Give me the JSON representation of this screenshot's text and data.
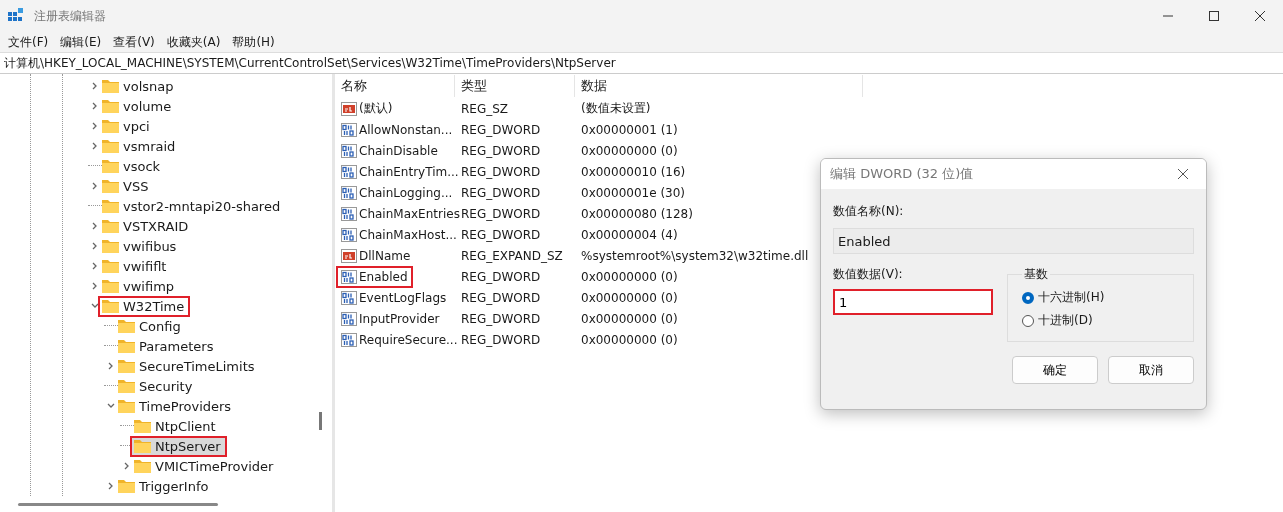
{
  "window": {
    "title": "注册表编辑器"
  },
  "menu": [
    "文件(F)",
    "编辑(E)",
    "查看(V)",
    "收藏夹(A)",
    "帮助(H)"
  ],
  "address": "计算机\\HKEY_LOCAL_MACHINE\\SYSTEM\\CurrentControlSet\\Services\\W32Time\\TimeProviders\\NtpServer",
  "tree": [
    {
      "label": "volsnap",
      "has_children": true,
      "expanded": false,
      "selected": false,
      "highlighted": false
    },
    {
      "label": "volume",
      "has_children": true,
      "expanded": false,
      "selected": false,
      "highlighted": false
    },
    {
      "label": "vpci",
      "has_children": true,
      "expanded": false,
      "selected": false,
      "highlighted": false
    },
    {
      "label": "vsmraid",
      "has_children": true,
      "expanded": false,
      "selected": false,
      "highlighted": false
    },
    {
      "label": "vsock",
      "has_children": false,
      "selected": false,
      "highlighted": false
    },
    {
      "label": "VSS",
      "has_children": true,
      "expanded": false,
      "selected": false,
      "highlighted": false
    },
    {
      "label": "vstor2-mntapi20-shared",
      "has_children": false,
      "selected": false,
      "highlighted": false
    },
    {
      "label": "VSTXRAID",
      "has_children": true,
      "expanded": false,
      "selected": false,
      "highlighted": false
    },
    {
      "label": "vwifibus",
      "has_children": true,
      "expanded": false,
      "selected": false,
      "highlighted": false
    },
    {
      "label": "vwififlt",
      "has_children": true,
      "expanded": false,
      "selected": false,
      "highlighted": false
    },
    {
      "label": "vwifimp",
      "has_children": true,
      "expanded": false,
      "selected": false,
      "highlighted": false
    },
    {
      "label": "W32Time",
      "has_children": true,
      "expanded": true,
      "selected": false,
      "highlighted": true,
      "children": [
        {
          "label": "Config",
          "has_children": false,
          "selected": false,
          "highlighted": false
        },
        {
          "label": "Parameters",
          "has_children": false,
          "selected": false,
          "highlighted": false
        },
        {
          "label": "SecureTimeLimits",
          "has_children": true,
          "expanded": false,
          "selected": false,
          "highlighted": false
        },
        {
          "label": "Security",
          "has_children": false,
          "selected": false,
          "highlighted": false
        },
        {
          "label": "TimeProviders",
          "has_children": true,
          "expanded": true,
          "selected": false,
          "highlighted": false,
          "children": [
            {
              "label": "NtpClient",
              "has_children": false,
              "selected": false,
              "highlighted": false
            },
            {
              "label": "NtpServer",
              "has_children": false,
              "selected": true,
              "highlighted": true
            },
            {
              "label": "VMICTimeProvider",
              "has_children": true,
              "expanded": false,
              "selected": false,
              "highlighted": false
            }
          ]
        },
        {
          "label": "TriggerInfo",
          "has_children": true,
          "expanded": false,
          "selected": false,
          "highlighted": false
        }
      ]
    }
  ],
  "values": {
    "columns": [
      "名称",
      "类型",
      "数据"
    ],
    "rows": [
      {
        "kind": "string",
        "name": "(默认)",
        "type": "REG_SZ",
        "data": "(数值未设置)",
        "highlighted": false
      },
      {
        "kind": "binary",
        "name": "AllowNonstan...",
        "type": "REG_DWORD",
        "data": "0x00000001 (1)",
        "highlighted": false
      },
      {
        "kind": "binary",
        "name": "ChainDisable",
        "type": "REG_DWORD",
        "data": "0x00000000 (0)",
        "highlighted": false
      },
      {
        "kind": "binary",
        "name": "ChainEntryTim...",
        "type": "REG_DWORD",
        "data": "0x00000010 (16)",
        "highlighted": false
      },
      {
        "kind": "binary",
        "name": "ChainLogging...",
        "type": "REG_DWORD",
        "data": "0x0000001e (30)",
        "highlighted": false
      },
      {
        "kind": "binary",
        "name": "ChainMaxEntries",
        "type": "REG_DWORD",
        "data": "0x00000080 (128)",
        "highlighted": false
      },
      {
        "kind": "binary",
        "name": "ChainMaxHost...",
        "type": "REG_DWORD",
        "data": "0x00000004 (4)",
        "highlighted": false
      },
      {
        "kind": "string",
        "name": "DllName",
        "type": "REG_EXPAND_SZ",
        "data": "%systemroot%\\system32\\w32time.dll",
        "highlighted": false
      },
      {
        "kind": "binary",
        "name": "Enabled",
        "type": "REG_DWORD",
        "data": "0x00000000 (0)",
        "highlighted": true
      },
      {
        "kind": "binary",
        "name": "EventLogFlags",
        "type": "REG_DWORD",
        "data": "0x00000000 (0)",
        "highlighted": false
      },
      {
        "kind": "binary",
        "name": "InputProvider",
        "type": "REG_DWORD",
        "data": "0x00000000 (0)",
        "highlighted": false
      },
      {
        "kind": "binary",
        "name": "RequireSecure...",
        "type": "REG_DWORD",
        "data": "0x00000000 (0)",
        "highlighted": false
      }
    ]
  },
  "dialog": {
    "title": "编辑 DWORD (32 位)值",
    "name_label": "数值名称(N):",
    "name_value": "Enabled",
    "data_label": "数值数据(V):",
    "data_value": "1",
    "data_highlighted": true,
    "base_label": "基数",
    "bases": [
      {
        "label": "十六进制(H)",
        "selected": true
      },
      {
        "label": "十进制(D)",
        "selected": false
      }
    ],
    "buttons": [
      "确定",
      "取消"
    ]
  }
}
